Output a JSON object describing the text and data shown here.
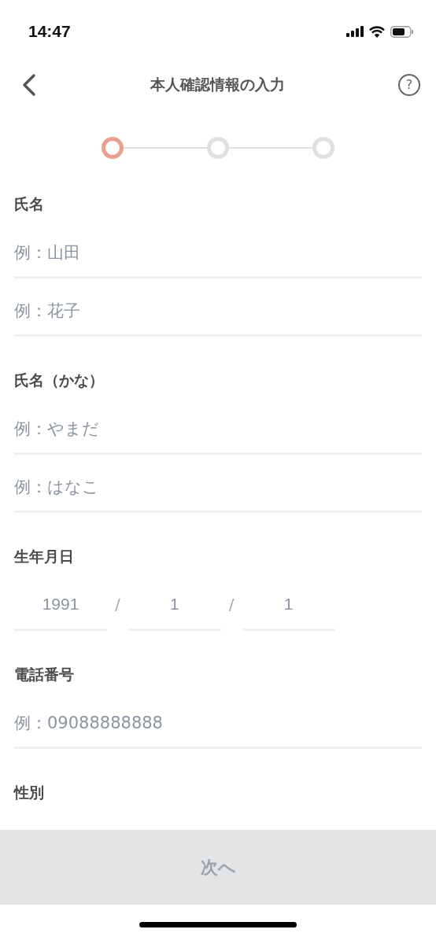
{
  "status_bar": {
    "time": "14:47"
  },
  "nav": {
    "title": "本人確認情報の入力",
    "help": "?"
  },
  "stepper": [
    {
      "selected": true
    },
    {
      "selected": false
    },
    {
      "selected": false
    }
  ],
  "sections": [
    {
      "label": "氏名",
      "kind": "text",
      "fields": [
        {
          "placeholder": "例：山田"
        },
        {
          "placeholder": "例：花子"
        }
      ]
    },
    {
      "label": "氏名（かな）",
      "kind": "text",
      "fields": [
        {
          "placeholder": "例：やまだ"
        },
        {
          "placeholder": "例：はなこ"
        }
      ]
    },
    {
      "label": "生年月日",
      "kind": "date",
      "fields": [
        {
          "placeholder": "1991"
        },
        {
          "placeholder": "1"
        },
        {
          "placeholder": "1"
        }
      ],
      "separator": "/"
    },
    {
      "label": "電話番号",
      "kind": "text",
      "fields": [
        {
          "placeholder": "例：09088888888"
        }
      ]
    },
    {
      "label": "性別",
      "kind": "text"
    }
  ],
  "next_button": {
    "label": "次へ",
    "disabled": true
  }
}
